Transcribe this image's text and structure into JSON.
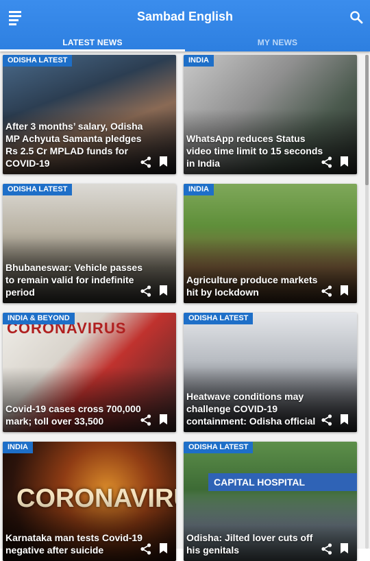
{
  "app": {
    "title": "Sambad English",
    "accent_color": "#2d7fe0",
    "badge_color": "#1e6fc8"
  },
  "tabs": [
    {
      "label": "LATEST NEWS",
      "active": true
    },
    {
      "label": "MY NEWS",
      "active": false
    }
  ],
  "icons": {
    "menu": "menu-icon",
    "search": "search-icon",
    "share": "share-icon",
    "bookmark": "bookmark-icon"
  },
  "articles": [
    {
      "category": "ODISHA LATEST",
      "headline": "After 3 months’ salary, Odisha MP Achyuta Samanta pledges Rs 2.5 Cr MPLAD funds for COVID-19"
    },
    {
      "category": "INDIA",
      "headline": "WhatsApp reduces Status video time limit to 15 seconds in India"
    },
    {
      "category": "ODISHA LATEST",
      "headline": "Bhubaneswar: Vehicle passes to remain valid for indefinite period"
    },
    {
      "category": "INDIA",
      "headline": "Agriculture produce markets hit by lockdown"
    },
    {
      "category": "INDIA & BEYOND",
      "headline": "Covid-19 cases cross 700,000 mark; toll over 33,500",
      "image_text": "CORONAVIRUS"
    },
    {
      "category": "ODISHA LATEST",
      "headline": "Heatwave conditions may challenge COVID-19 containment: Odisha official"
    },
    {
      "category": "INDIA",
      "headline": "Karnataka man tests Covid-19 negative after suicide",
      "image_text": "CORONAVIRUS"
    },
    {
      "category": "ODISHA LATEST",
      "headline": "Odisha: Jilted lover cuts off his genitals",
      "image_text": "CAPITAL HOSPITAL"
    }
  ]
}
